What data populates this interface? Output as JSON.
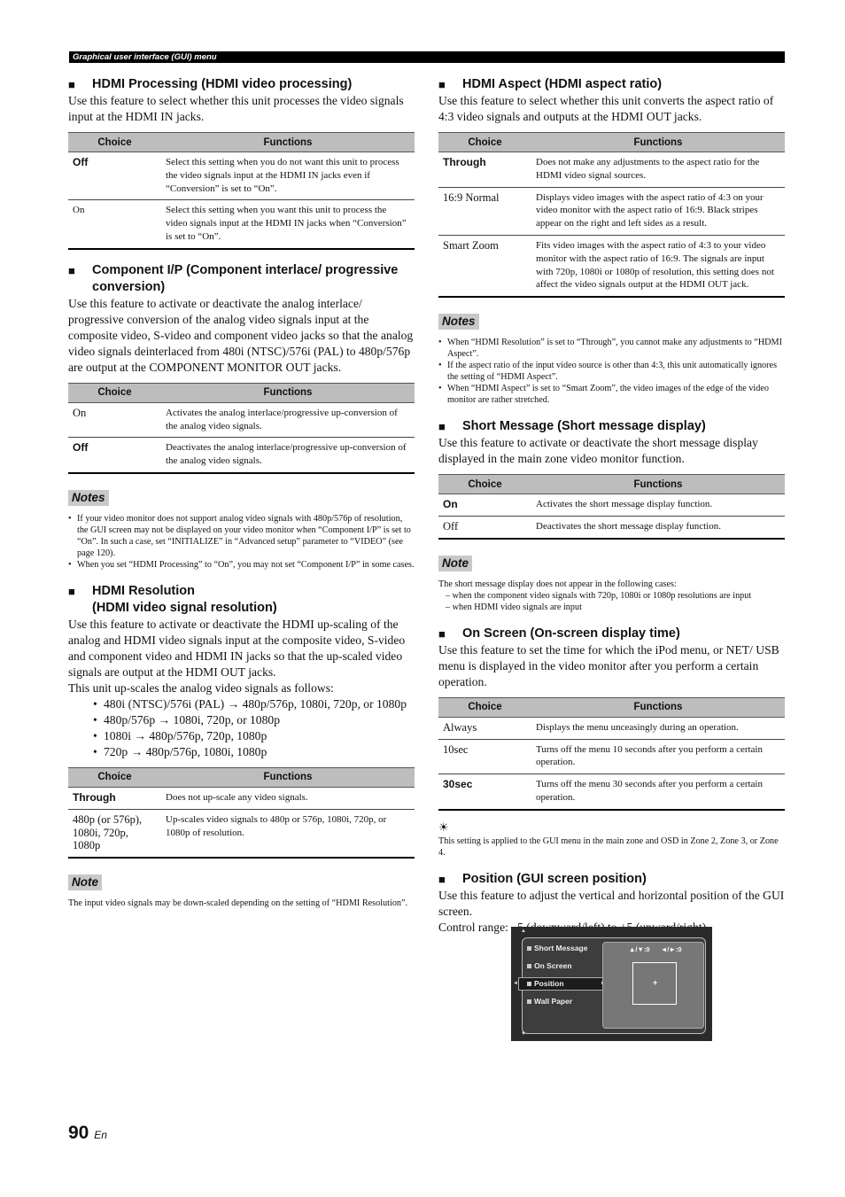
{
  "header": {
    "title": "Graphical user interface (GUI) menu"
  },
  "table_headers": {
    "choice": "Choice",
    "functions": "Functions"
  },
  "left": {
    "hdmi_processing": {
      "title": "HDMI Processing (HDMI video processing)",
      "body": "Use this feature to select whether this unit processes the video signals input at the HDMI IN jacks.",
      "rows": [
        {
          "choice": "Off",
          "function": "Select this setting when you do not want this unit to process the video signals input at the HDMI IN jacks even if “Conversion” is set to “On”."
        },
        {
          "choice": "On",
          "function": "Select this setting when you want this unit to process the video signals input at the HDMI IN jacks when “Conversion” is set to “On”."
        }
      ]
    },
    "component_ip": {
      "title": "Component I/P (Component interlace/ progressive conversion)",
      "body": "Use this feature to activate or deactivate the analog interlace/ progressive conversion of the analog video signals input at the composite video, S-video and component video jacks so that the analog video signals deinterlaced from 480i (NTSC)/576i (PAL) to 480p/576p are output at the COMPONENT MONITOR OUT jacks.",
      "rows": [
        {
          "choice": "On",
          "function": "Activates the analog interlace/progressive up-conversion of the analog video signals."
        },
        {
          "choice": "Off",
          "function": "Deactivates the analog interlace/progressive up-conversion of the analog video signals."
        }
      ],
      "notes_label": "Notes",
      "notes": [
        "If your video monitor does not support analog video signals with 480p/576p of resolution, the GUI screen may not be displayed on your video monitor when “Component I/P” is set to “On”. In such a case, set “INITIALIZE” in “Advanced setup” parameter to “VIDEO” (see page 120).",
        "When you set “HDMI Processing” to “On”, you may not set “Component I/P” in some cases."
      ]
    },
    "hdmi_resolution": {
      "title_line1": "HDMI Resolution",
      "title_line2": "(HDMI video signal resolution)",
      "body": "Use this feature to activate or deactivate the HDMI up-scaling of the analog and HDMI video signals input at the composite video, S-video and component video and HDMI IN jacks so that the up-scaled video signals are output at the HDMI OUT jacks.",
      "body2": "This unit up-scales the analog video signals as follows:",
      "bullets": [
        "480i (NTSC)/576i (PAL) → 480p/576p, 1080i, 720p, or 1080p",
        "480p/576p → 1080i, 720p, or 1080p",
        "1080i → 480p/576p, 720p, 1080p",
        "720p → 480p/576p, 1080i, 1080p"
      ],
      "rows": [
        {
          "choice": "Through",
          "function": "Does not up-scale any video signals."
        },
        {
          "choice": "480p (or 576p), 1080i, 720p, 1080p",
          "function": "Up-scales video signals to 480p or 576p, 1080i, 720p, or 1080p of resolution."
        }
      ],
      "note_label": "Note",
      "note": "The input video signals may be down-scaled depending on the setting of “HDMI Resolution”."
    }
  },
  "right": {
    "hdmi_aspect": {
      "title": "HDMI Aspect (HDMI aspect ratio)",
      "body": "Use this feature to select whether this unit converts the aspect ratio of 4:3 video signals and outputs at the HDMI OUT jacks.",
      "rows": [
        {
          "choice": "Through",
          "function": "Does not make any adjustments to the aspect ratio for the HDMI video signal sources."
        },
        {
          "choice": "16:9 Normal",
          "function": "Displays video images with the aspect ratio of 4:3 on your video monitor with the aspect ratio of 16:9. Black stripes appear on the right and left sides as a result."
        },
        {
          "choice": "Smart Zoom",
          "function": "Fits video images with the aspect ratio of 4:3 to your video monitor with the aspect ratio of 16:9. The signals are input with 720p, 1080i or 1080p of resolution, this setting does not affect the video signals output at the HDMI OUT jack."
        }
      ],
      "notes_label": "Notes",
      "notes": [
        "When “HDMI Resolution” is set to “Through”, you cannot make any adjustments to “HDMI Aspect”.",
        "If the aspect ratio of the input video source is other than 4:3, this unit automatically ignores the setting of “HDMI Aspect”.",
        "When “HDMI Aspect” is set to “Smart Zoom”, the video images of the edge of the video monitor are rather stretched."
      ]
    },
    "short_message": {
      "title": "Short Message (Short message display)",
      "body": "Use this feature to activate or deactivate the short message display displayed in the main zone video monitor function.",
      "rows": [
        {
          "choice": "On",
          "function": "Activates the short message display function."
        },
        {
          "choice": "Off",
          "function": "Deactivates the short message display function."
        }
      ],
      "note_label": "Note",
      "note_intro": "The short message display does not appear in the following cases:",
      "note_items": [
        "– when the component video signals with 720p, 1080i or 1080p resolutions are input",
        "– when HDMI video signals are input"
      ]
    },
    "on_screen": {
      "title": "On Screen (On-screen display time)",
      "body": "Use this feature to set the time for which the iPod menu, or NET/ USB menu is displayed in the video monitor after you perform a certain operation.",
      "rows": [
        {
          "choice": "Always",
          "function": "Displays the menu unceasingly during an operation."
        },
        {
          "choice": "10sec",
          "function": "Turns off the menu 10 seconds after you perform a certain operation."
        },
        {
          "choice": "30sec",
          "function": "Turns off the menu 30 seconds after you perform a certain operation."
        }
      ],
      "hint_icon": "☀",
      "hint": "This setting is applied to the GUI menu in the main zone and OSD in Zone 2, Zone 3, or Zone 4."
    },
    "position": {
      "title": "Position (GUI screen position)",
      "body": "Use this feature to adjust the vertical and horizontal position of the GUI screen.",
      "body2": "Control range: –5 (downward/left) to +5 (upward/right)"
    },
    "gui_screen": {
      "menu": [
        "Short Message",
        "On Screen",
        "Position",
        "Wall Paper"
      ],
      "selected": "Position",
      "vertical_readout": "▲/▼:0",
      "horizontal_readout": "◄/►:0",
      "center_mark": "+"
    }
  },
  "footer": {
    "page": "90",
    "lang": "En"
  }
}
